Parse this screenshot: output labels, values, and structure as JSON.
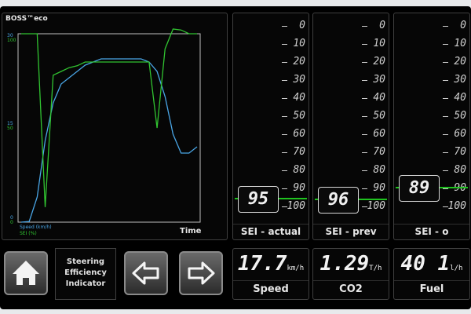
{
  "app": {
    "brand": "BOSS™eco"
  },
  "chart_data": {
    "type": "line",
    "xlabel": "Time",
    "y_left_speed": {
      "label": "Speed (km/h)",
      "ticks": [
        "0",
        "15",
        "30"
      ],
      "range": [
        0,
        30
      ]
    },
    "y_left_sei": {
      "label": "SEI (%)",
      "ticks": [
        "0",
        "50",
        "100"
      ],
      "range": [
        0,
        100
      ]
    },
    "series": [
      {
        "name": "Speed (km/h)",
        "color": "#4aa6e6",
        "values": [
          0,
          0.1,
          4,
          13,
          19,
          22,
          23,
          24,
          25,
          25.5,
          26,
          26,
          26,
          26,
          26,
          26,
          25.5,
          24,
          20,
          14,
          11,
          11,
          12
        ]
      },
      {
        "name": "SEI (%)",
        "color": "#31c431",
        "values": [
          100,
          100,
          100,
          8,
          78,
          80,
          82,
          83,
          85,
          85,
          85,
          85,
          85,
          85,
          85,
          85,
          85,
          50,
          92,
          103,
          102,
          100,
          100
        ]
      }
    ],
    "x": [
      0,
      1,
      2,
      3,
      4,
      5,
      6,
      7,
      8,
      9,
      10,
      11,
      12,
      13,
      14,
      15,
      16,
      17,
      18,
      19,
      20,
      21,
      22
    ]
  },
  "scale": {
    "ticks": [
      "0",
      "10",
      "20",
      "30",
      "40",
      "50",
      "60",
      "70",
      "80",
      "90",
      "100"
    ]
  },
  "columns": [
    {
      "label": "SEI - actual",
      "value": "95"
    },
    {
      "label": "SEI - prev",
      "value": "96"
    },
    {
      "label": "SEI - o",
      "value": "89"
    }
  ],
  "metrics": [
    {
      "label": "Speed",
      "value": "17.7",
      "unit": "km/h"
    },
    {
      "label": "CO2",
      "value": "1.29",
      "unit": "T/h"
    },
    {
      "label": "Fuel",
      "value": "40 1",
      "unit": "l/h"
    }
  ],
  "indicator": {
    "line1": "Steering",
    "line2": "Efficiency",
    "line3": "Indicator"
  },
  "icons": {
    "home": "home-icon",
    "left": "arrow-left-icon",
    "right": "arrow-right-icon"
  }
}
